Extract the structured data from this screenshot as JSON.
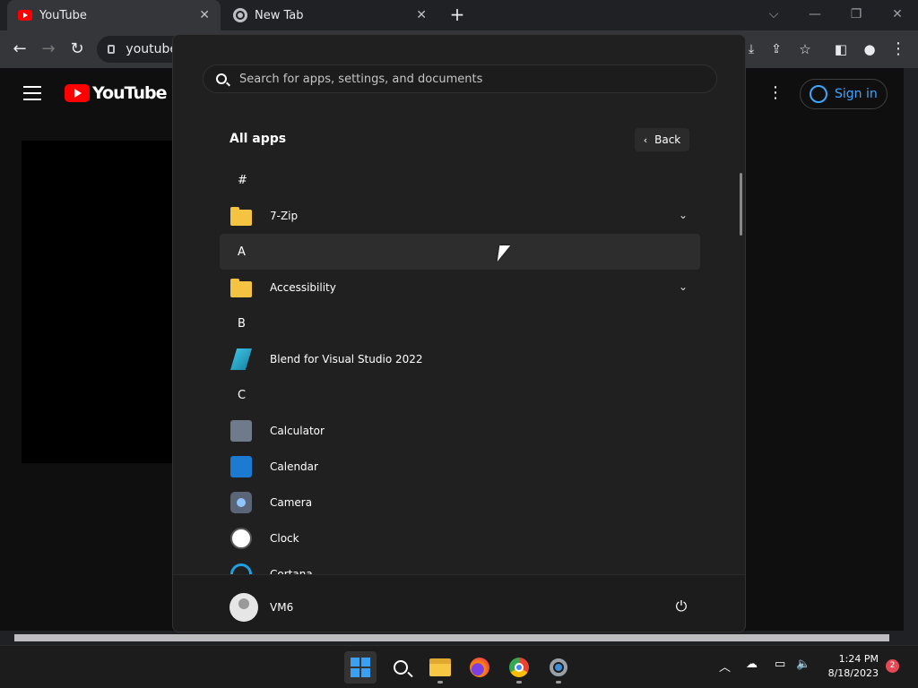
{
  "browser": {
    "tabs": [
      {
        "title": "YouTube",
        "icon": "youtube-favicon"
      },
      {
        "title": "New Tab",
        "icon": "chrome-favicon"
      }
    ],
    "address": "youtube",
    "window_controls": [
      "⌵",
      "—",
      "❐",
      "✕"
    ]
  },
  "youtube": {
    "logo_text": "YouTube",
    "sign_in_label": "Sign in",
    "colors": {
      "brand": "#ff0000",
      "link": "#3ea6ff"
    }
  },
  "start_menu": {
    "search_placeholder": "Search for apps, settings, and documents",
    "all_apps_title": "All apps",
    "back_label": "Back",
    "list": [
      {
        "kind": "letter",
        "text": "#"
      },
      {
        "kind": "app",
        "text": "7-Zip",
        "icon": "folder-icon",
        "expandable": true
      },
      {
        "kind": "letter",
        "text": "A"
      },
      {
        "kind": "app",
        "text": "Accessibility",
        "icon": "folder-icon",
        "expandable": true
      },
      {
        "kind": "letter",
        "text": "B"
      },
      {
        "kind": "app",
        "text": "Blend for Visual Studio 2022",
        "icon": "blend-icon"
      },
      {
        "kind": "letter",
        "text": "C"
      },
      {
        "kind": "app",
        "text": "Calculator",
        "icon": "calculator-icon"
      },
      {
        "kind": "app",
        "text": "Calendar",
        "icon": "calendar-icon"
      },
      {
        "kind": "app",
        "text": "Camera",
        "icon": "camera-icon"
      },
      {
        "kind": "app",
        "text": "Clock",
        "icon": "clock-icon"
      },
      {
        "kind": "app",
        "text": "Cortana",
        "icon": "cortana-icon"
      }
    ],
    "user_name": "VM6",
    "power_icon": "⏻"
  },
  "taskbar": {
    "time": "1:24 PM",
    "date": "8/18/2023",
    "notification_count": "2",
    "tray_icons": [
      "chevron-up-icon",
      "onedrive-offline-icon",
      "network-icon",
      "volume-icon"
    ]
  }
}
